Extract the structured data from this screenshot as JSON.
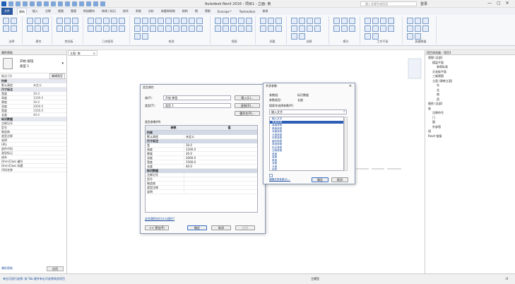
{
  "titlebar": {
    "title": "Autodesk Revit 2016 - 项目1 - 立面: 南",
    "search_placeholder": "键入关键字或短语",
    "account": "登录",
    "window_controls": [
      "—",
      "▢",
      "✕"
    ]
  },
  "tabs": [
    "文件",
    "建筑",
    "插入",
    "注释",
    "视图",
    "管理",
    "附加模块",
    "修改 | 标记",
    "协作",
    "系统",
    "分析",
    "体量和场地",
    "结构",
    "钢",
    "预制",
    "Enscape™",
    "Twinmotion",
    "修改"
  ],
  "active_tab_index": 1,
  "ribbon": {
    "groups": [
      "选择",
      "属性",
      "剪贴板",
      "几何图形",
      "修改",
      "视图",
      "测量",
      "创建",
      "模式",
      "工作平面",
      "族编辑器"
    ]
  },
  "properties": {
    "type_name": "开始 按钮",
    "type_sub": "类型 1",
    "edit_type_label": "编辑类型",
    "selector": "标记 (1)",
    "sections": [
      {
        "name": "约束",
        "rows": [
          [
            "默认高程",
            "未定义"
          ]
        ]
      },
      {
        "name": "尺寸标注",
        "rows": [
          [
            "宽度",
            "30.0"
          ],
          [
            "高度",
            "1200.0"
          ],
          [
            "厚度",
            "30.0"
          ],
          [
            "深度",
            "2000.0"
          ],
          [
            "宽度",
            "1500.0"
          ],
          [
            "长度",
            "40.0"
          ]
        ]
      },
      {
        "name": "标识数据",
        "rows": [
          [
            "注释记号",
            ""
          ],
          [
            "型号",
            ""
          ],
          [
            "制造商",
            ""
          ],
          [
            "类型注释",
            ""
          ],
          [
            "说明",
            ""
          ],
          [
            "URL",
            ""
          ],
          [
            "部件代码",
            ""
          ],
          [
            "类型标记",
            ""
          ],
          [
            "成本",
            ""
          ],
          [
            "OmniClass 编号",
            ""
          ],
          [
            "OmniClass 标题",
            ""
          ],
          [
            "代码名称",
            ""
          ]
        ]
      }
    ],
    "apply_label": "应用",
    "help_label": "属性帮助"
  },
  "view": {
    "tab_label": "立面: 南",
    "tab_close": "×"
  },
  "browser": {
    "title": "项目浏览器 - 项目1",
    "items": [
      "视图 (全部)",
      "楼层平面",
      "参照标高",
      "天花板平面",
      "三维视图",
      "立面 (建筑立面)",
      "东",
      "北",
      "南",
      "西",
      "图纸 (全部)",
      "族",
      "注释符号",
      "门",
      "窗",
      "外部墙",
      "组",
      "Revit 链接"
    ]
  },
  "type_dialog": {
    "title": "类型属性",
    "family_label": "族(F):",
    "family_value": "开始 按钮",
    "type_label": "类型(T):",
    "type_value": "类型 1",
    "load_btn": "载入(L)...",
    "dup_btn": "复制(D)...",
    "rename_btn": "重命名(R)...",
    "params_label": "类型参数(M)",
    "col_param": "参数",
    "col_value": "值",
    "sections": [
      {
        "name": "约束",
        "rows": [
          [
            "默认高程",
            "未定义"
          ]
        ]
      },
      {
        "name": "尺寸标注",
        "rows": [
          [
            "宽",
            "30.0"
          ],
          [
            "高度",
            "1200.0"
          ],
          [
            "厚度",
            "30.0"
          ],
          [
            "深度",
            "2000.0"
          ],
          [
            "宽度",
            "1500.0"
          ],
          [
            "长度",
            "40.0"
          ]
        ]
      },
      {
        "name": "标识数据",
        "rows": [
          [
            "注释记号",
            ""
          ],
          [
            "型号",
            ""
          ],
          [
            "制造商",
            ""
          ],
          [
            "类型注释",
            ""
          ],
          [
            "说明",
            ""
          ]
        ]
      }
    ],
    "help_link": "这些属性执行什么操作?",
    "preview_btn": "<< 预览(P)",
    "ok_btn": "确定",
    "cancel_btn": "取消",
    "apply_btn": "应用"
  },
  "shared_dialog": {
    "title": "共享参数",
    "group_label": "参数组:",
    "group_value": "标识数据",
    "type_label": "参数类型:",
    "type_value": "长度",
    "filter_label": "搜索并选择参数(P):",
    "filter_value": "输入文字",
    "list": [
      "输入文字",
      "宽度参数",
      "高度参数",
      "厚度参数",
      "深度参数",
      "长度参数",
      "材质参数",
      "编号参数",
      "类型参数",
      "标记参数",
      "注释参数",
      "宽度",
      "高度",
      "厚度",
      "深度",
      "长度",
      "材质"
    ],
    "selected_index": 1,
    "edit_link": "编辑共享参数(E)...",
    "ok_btn": "确定",
    "cancel_btn": "取消"
  },
  "status": {
    "left": "单击可进行选择; 按 Tab 键并单击可选择其他项目",
    "model": "主模型",
    "zoom": ":0"
  }
}
